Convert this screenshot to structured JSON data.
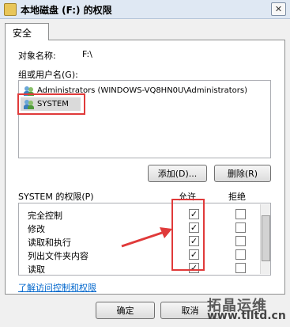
{
  "window": {
    "title": "本地磁盘 (F:) 的权限",
    "close_glyph": "✕"
  },
  "tabs": [
    {
      "label": "安全"
    }
  ],
  "object": {
    "label": "对象名称:",
    "value": "F:\\"
  },
  "groups": {
    "label": "组或用户名(G):",
    "items": [
      {
        "name": "Administrators (WINDOWS-VQ8HN0U\\Administrators)"
      },
      {
        "name": "SYSTEM",
        "selected": true
      }
    ]
  },
  "buttons": {
    "add": "添加(D)...",
    "remove": "删除(R)",
    "ok": "确定",
    "cancel": "取消"
  },
  "permissions": {
    "label": "SYSTEM 的权限(P)",
    "allow_header": "允许",
    "deny_header": "拒绝",
    "rows": [
      {
        "name": "完全控制",
        "allow": true,
        "deny": false
      },
      {
        "name": "修改",
        "allow": true,
        "deny": false
      },
      {
        "name": "读取和执行",
        "allow": true,
        "deny": false
      },
      {
        "name": "列出文件夹内容",
        "allow": true,
        "deny": false
      },
      {
        "name": "读取",
        "allow": true,
        "deny": false
      }
    ]
  },
  "link": "了解访问控制和权限",
  "watermark": {
    "line1": "拓晶运维",
    "line2": "www.tlltd.cn"
  },
  "colors": {
    "highlight": "#e03a3a",
    "link": "#0066cc"
  }
}
